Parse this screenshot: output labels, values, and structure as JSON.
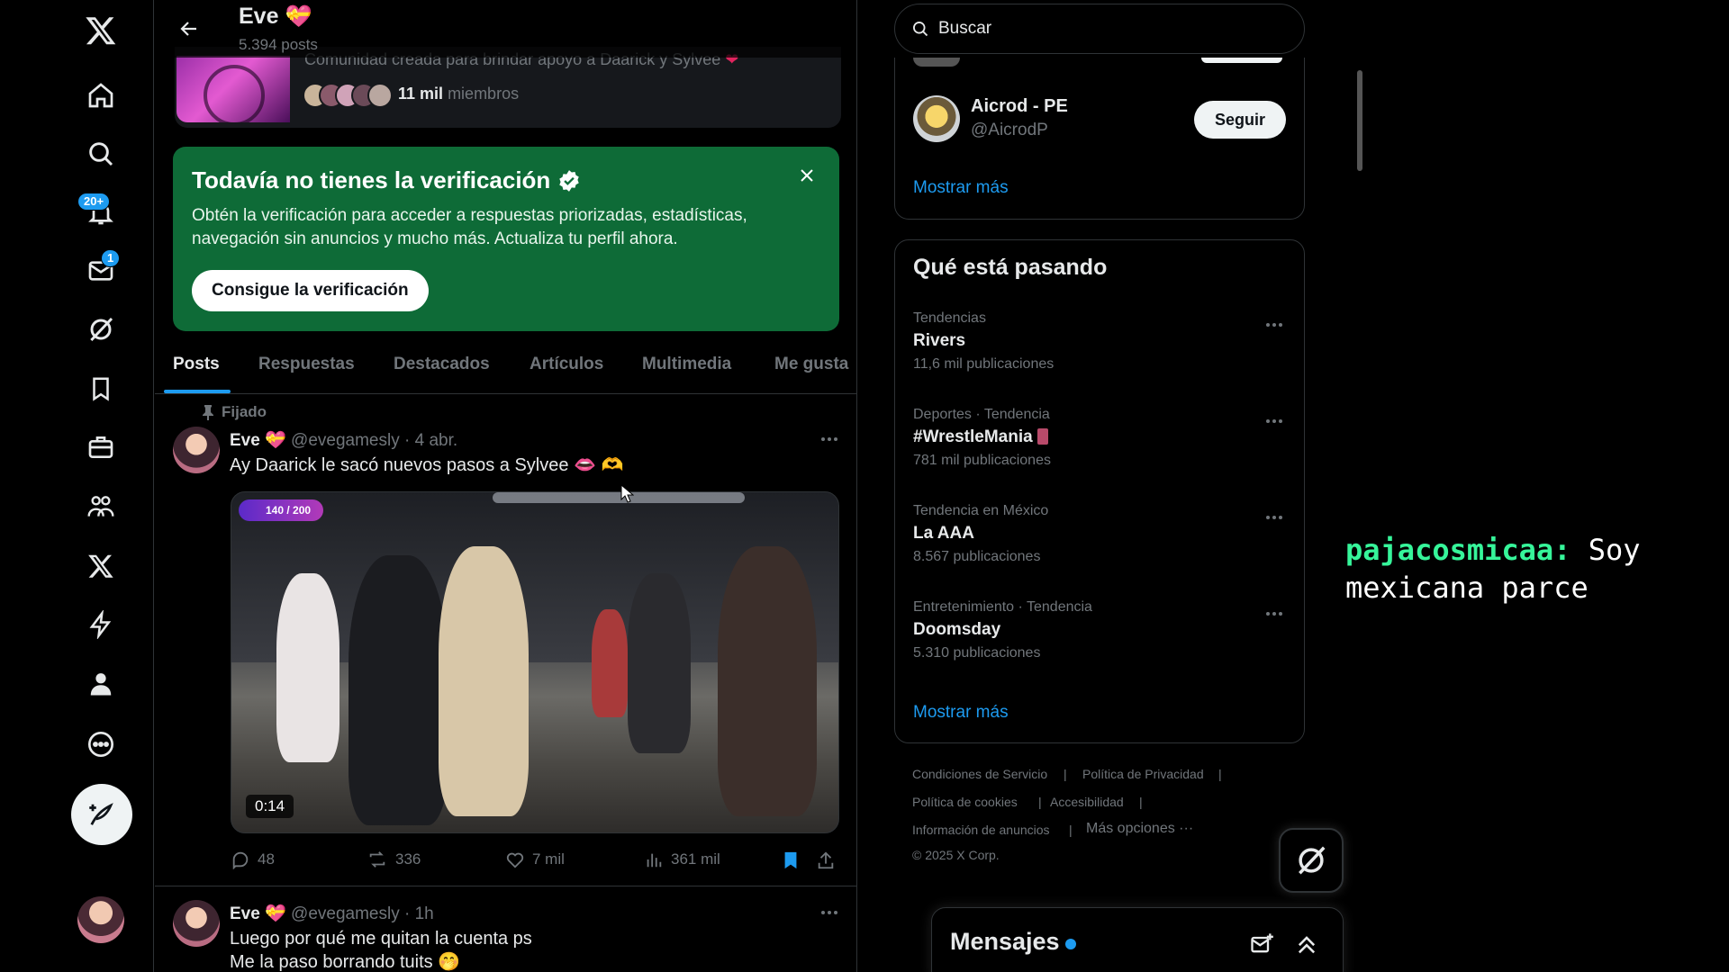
{
  "profile": {
    "name": "Eve",
    "posts_count": "5.394 posts"
  },
  "community": {
    "description": "Comunidad creada para brindar apoyo a Daarick y Sylvee",
    "members_count": "11 mil",
    "members_label": "miembros"
  },
  "nav": {
    "notifications_badge": "20+",
    "messages_badge": "1"
  },
  "verification": {
    "title": "Todavía no tienes la verificación",
    "body": "Obtén la verificación para acceder a respuestas priorizadas, estadísticas, navegación sin anuncios y mucho más. Actualiza tu perfil ahora.",
    "button": "Consigue la verificación"
  },
  "tabs": [
    "Posts",
    "Respuestas",
    "Destacados",
    "Artículos",
    "Multimedia",
    "Me gusta"
  ],
  "posts": [
    {
      "pinned_label": "Fijado",
      "name": "Eve",
      "handle": "@evegamesly",
      "date": "· 4 abr.",
      "text": "Ay Daarick le sacó nuevos pasos a Sylvee",
      "video_duration": "0:14",
      "video_overlay": "140 / 200",
      "replies": "48",
      "reposts": "336",
      "likes": "7 mil",
      "views": "361 mil"
    },
    {
      "name": "Eve",
      "handle": "@evegamesly",
      "date": "· 1h",
      "line1": "Luego por qué me quitan la cuenta ps",
      "line2": "Me la paso borrando tuits"
    }
  ],
  "search": {
    "placeholder": "Buscar"
  },
  "who_to_follow": {
    "name": "Aicrod - PE",
    "handle": "@AicrodP",
    "follow_button": "Seguir",
    "show_more": "Mostrar más"
  },
  "trends": {
    "title": "Qué está pasando",
    "items": [
      {
        "context": "Tendencias",
        "title": "Rivers",
        "count": "11,6 mil publicaciones"
      },
      {
        "context": "Deportes · Tendencia",
        "title": "#WrestleMania",
        "count": "781 mil publicaciones"
      },
      {
        "context": "Tendencia en México",
        "title": "La AAA",
        "count": "8.567 publicaciones"
      },
      {
        "context": "Entretenimiento · Tendencia",
        "title": "Doomsday",
        "count": "5.310 publicaciones"
      }
    ],
    "show_more": "Mostrar más"
  },
  "footer": {
    "terms": "Condiciones de Servicio",
    "privacy": "Política de Privacidad",
    "cookies": "Política de cookies",
    "accessibility": "Accesibilidad",
    "ads_info": "Información de anuncios",
    "more": "Más opciones ···",
    "copyright": "© 2025 X Corp."
  },
  "messages": {
    "title": "Mensajes"
  },
  "chat_overlay": {
    "user": "pajacosmicaa:",
    "message": "Soy mexicana parce"
  },
  "colors": {
    "accent": "#1d9bf0",
    "verify_bg": "#0e6b37",
    "chat_user": "#36f59a",
    "background": "#000000"
  }
}
